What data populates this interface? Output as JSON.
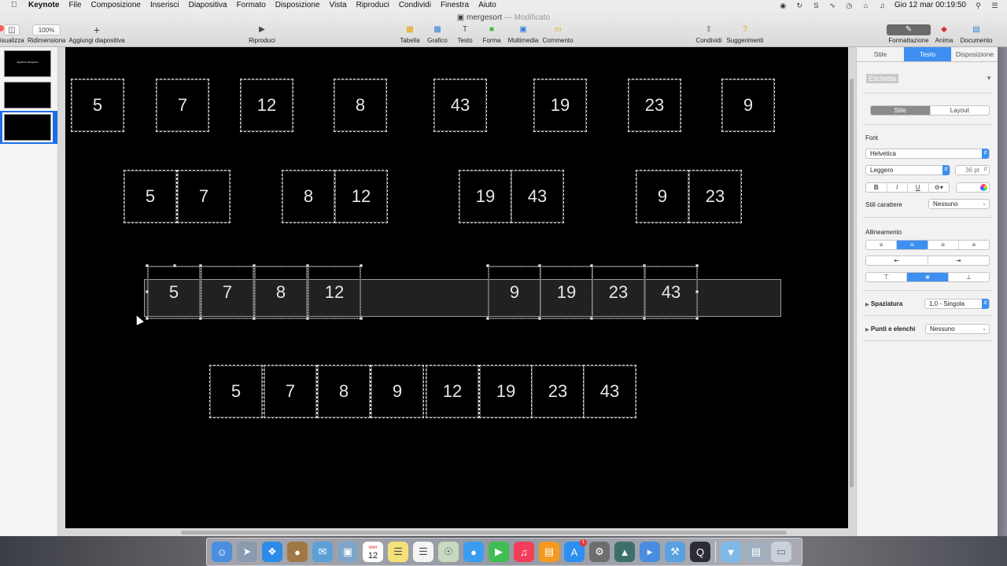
{
  "menubar": {
    "apple": "",
    "items": [
      "Keynote",
      "File",
      "Composizione",
      "Inserisci",
      "Diapositiva",
      "Formato",
      "Disposizione",
      "Vista",
      "Riproduci",
      "Condividi",
      "Finestra",
      "Aiuto"
    ],
    "clock": "Gio 12 mar  00:19:50"
  },
  "window": {
    "title": "mergesort",
    "status": "Modificato"
  },
  "toolbar": {
    "view": "isualizza",
    "zoom_value": "100%",
    "zoom": "Ridimensiona",
    "add_slide": "Aggiungi diapositiva",
    "play": "Riproduci",
    "table": "Tabella",
    "chart": "Grafico",
    "text": "Testo",
    "shape": "Forma",
    "media": "Multimedia",
    "comment": "Commento",
    "share": "Condividi",
    "tips": "Suggerimenti",
    "format": "Formattazione",
    "animate": "Anima",
    "document": "Documento"
  },
  "navigator": {
    "slide1_title": "Algoritmo Mergesort"
  },
  "slide": {
    "row1": [
      "5",
      "7",
      "12",
      "8",
      "43",
      "19",
      "23",
      "9"
    ],
    "row2": [
      [
        "5",
        "7"
      ],
      [
        "8",
        "12"
      ],
      [
        "19",
        "43"
      ],
      [
        "9",
        "23"
      ]
    ],
    "row3": [
      [
        "5",
        "7",
        "8",
        "12"
      ],
      [
        "9",
        "19",
        "23",
        "43"
      ]
    ],
    "row4": [
      "5",
      "7",
      "8",
      "9",
      "12",
      "19",
      "23",
      "43"
    ]
  },
  "inspector": {
    "tabs": [
      "Stile",
      "Testo",
      "Disposizione"
    ],
    "active_tab": "Testo",
    "paragraph_style": "Etichetta",
    "subtabs": [
      "Stile",
      "Layout"
    ],
    "font_section": "Font",
    "font_family": "Helvetica",
    "font_weight": "Leggero",
    "font_size": "36 pt",
    "bold": "B",
    "italic": "I",
    "underline": "U",
    "char_styles_label": "Stili carattere",
    "char_styles_value": "Nessuno",
    "alignment_label": "Allineamento",
    "spacing_label": "Spaziatura",
    "spacing_value": "1,0 - Singola",
    "bullets_label": "Punti e elenchi",
    "bullets_value": "Nessuno"
  },
  "dock": {
    "calendar_month": "MAR",
    "calendar_day": "12",
    "appstore_badge": "1"
  }
}
